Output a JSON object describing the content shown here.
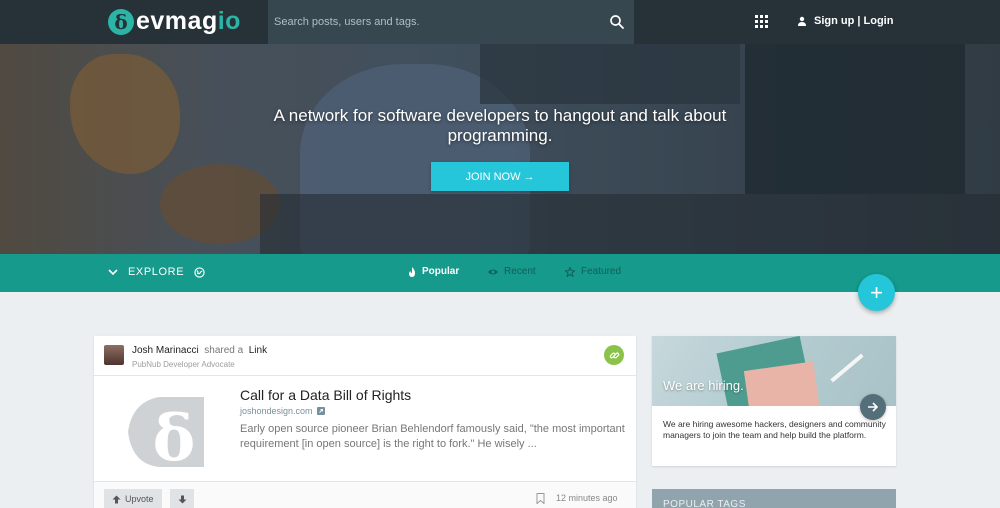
{
  "header": {
    "logo": {
      "mark": "δ",
      "text_main": "evmag",
      "text_tail": "io"
    },
    "search": {
      "placeholder": "Search posts, users and tags."
    },
    "auth": {
      "label": "Sign up | Login"
    }
  },
  "hero": {
    "headline": "A network for software developers to hangout and talk about programming.",
    "cta": "JOIN NOW →"
  },
  "explore": {
    "label": "EXPLORE",
    "tabs": [
      {
        "label": "Popular",
        "active": true,
        "icon": "flame-icon"
      },
      {
        "label": "Recent",
        "active": false,
        "icon": "eye-icon"
      },
      {
        "label": "Featured",
        "active": false,
        "icon": "star-icon"
      }
    ],
    "fab": "+"
  },
  "post": {
    "author": "Josh Marinacci",
    "action": "shared a",
    "type": "Link",
    "role": "PubNub Developer Advocate",
    "thumb_glyph": "δ",
    "title": "Call for a Data Bill of Rights",
    "domain": "joshondesign.com",
    "excerpt": "Early open source pioneer Brian Behlendorf famously said, \"the most important requirement [in open source] is the right to fork.\" He wisely ...",
    "upvote_label": "Upvote",
    "time": "12 minutes ago"
  },
  "sidebar": {
    "hiring": {
      "title": "We are hiring.",
      "text": "We are hiring awesome hackers, designers and community managers to join the team and help build the platform."
    },
    "popular_tags": {
      "title": "POPULAR TAGS"
    }
  },
  "colors": {
    "header_bg": "#263238",
    "accent_teal": "#159a8c",
    "accent_cyan": "#26c6da",
    "link_badge": "#8bc34a"
  }
}
